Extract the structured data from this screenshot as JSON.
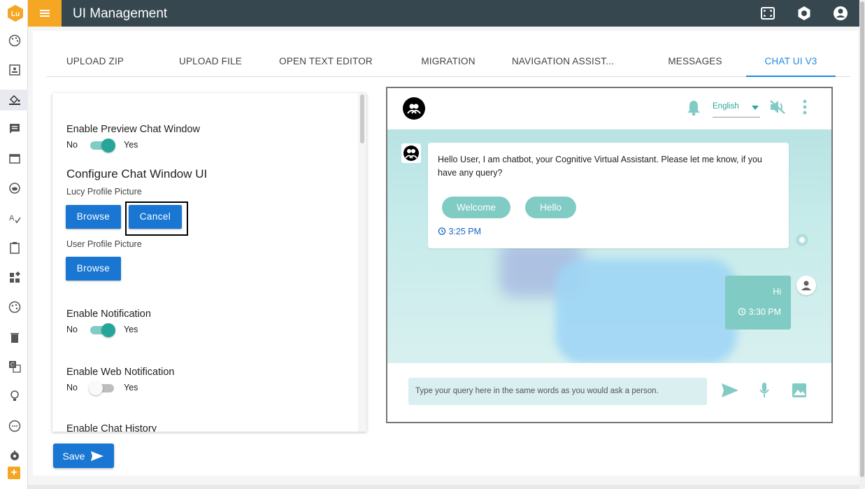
{
  "app": {
    "title": "UI Management"
  },
  "tabs": [
    {
      "label": "UPLOAD ZIP"
    },
    {
      "label": "UPLOAD FILE"
    },
    {
      "label": "OPEN TEXT EDITOR"
    },
    {
      "label": "MIGRATION"
    },
    {
      "label": "NAVIGATION ASSIST..."
    },
    {
      "label": "MESSAGES"
    },
    {
      "label": "CHAT UI V3",
      "active": true
    }
  ],
  "settings": {
    "preview": {
      "label": "Enable Preview Chat Window",
      "no": "No",
      "yes": "Yes",
      "on": true
    },
    "configure_heading": "Configure Chat Window UI",
    "lucy_picture": "Lucy Profile Picture",
    "browse_label": "Browse",
    "cancel_label": "Cancel",
    "user_picture": "User Profile Picture",
    "notification": {
      "label": "Enable Notification",
      "no": "No",
      "yes": "Yes",
      "on": true
    },
    "web_notification": {
      "label": "Enable Web Notification",
      "no": "No",
      "yes": "Yes",
      "on": false
    },
    "chat_history": {
      "label": "Enable Chat History"
    }
  },
  "save_label": "Save",
  "chat": {
    "language": "English",
    "bot_message": "Hello User, I am chatbot, your Cognitive Virtual Assistant. Please let me know, if you have any query?",
    "chips": [
      "Welcome",
      "Hello"
    ],
    "bot_time": "3:25 PM",
    "user_message": "Hi",
    "user_time": "3:30 PM",
    "input_placeholder": "Type your query here in the same words as you would ask a person."
  },
  "colors": {
    "topbar": "#37474f",
    "accent_orange": "#f5a623",
    "primary_blue": "#1976d2",
    "teal": "#80cbc4",
    "active_tab": "#1e88e5"
  }
}
